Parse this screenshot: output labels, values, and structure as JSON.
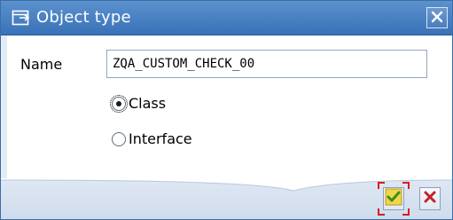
{
  "dialog": {
    "title": "Object type",
    "title_icon": "object-type-icon",
    "close_icon": "close-icon"
  },
  "form": {
    "name_label": "Name",
    "name_value": "ZQA_CUSTOM_CHECK_00",
    "options": [
      {
        "label": "Class",
        "selected": true
      },
      {
        "label": "Interface",
        "selected": false
      }
    ]
  },
  "footer": {
    "ok_icon": "checkmark-icon",
    "cancel_icon": "cancel-x-icon"
  },
  "colors": {
    "titlebar": "#3a72b8",
    "body": "#ffffff",
    "footer": "#cfdcec",
    "ok_check": "#3a8f1e",
    "cancel_x": "#c8202a",
    "focus_frame": "#d42020"
  }
}
